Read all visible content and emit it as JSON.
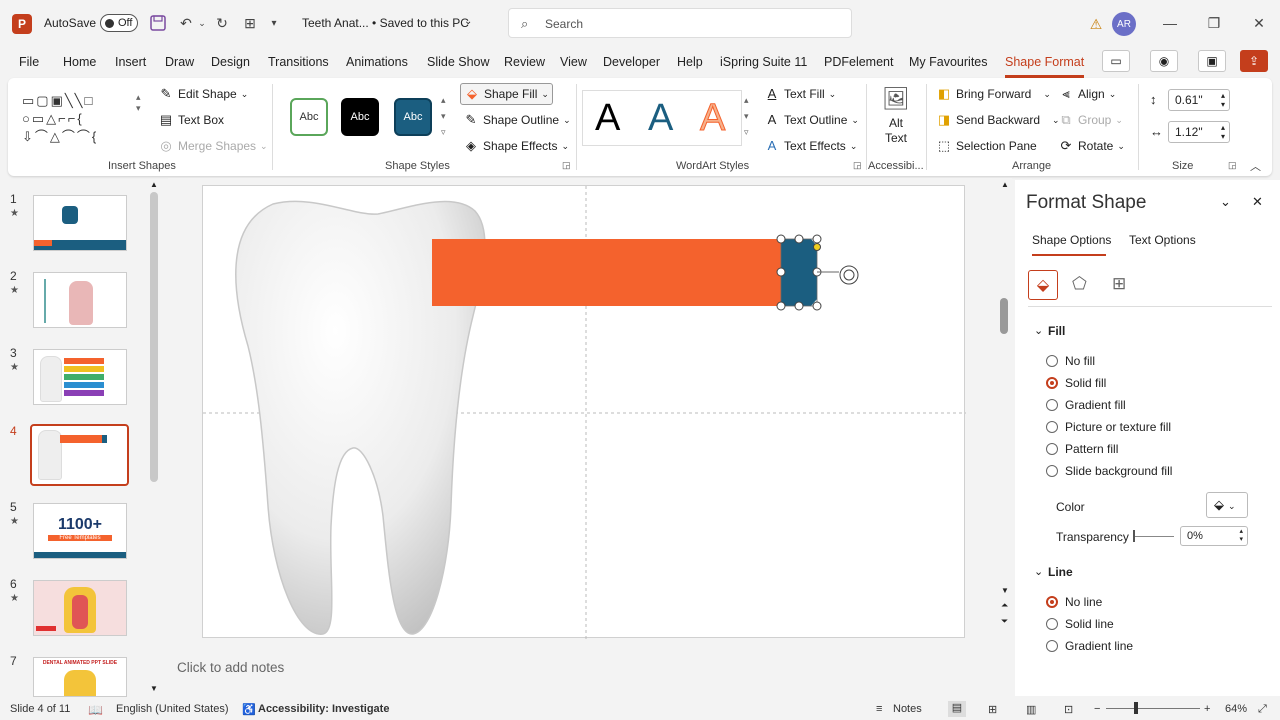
{
  "titlebar": {
    "app_icon": "P",
    "autosave_label": "AutoSave",
    "autosave_state": "Off",
    "doc_title": "Teeth Anat... • Saved to this PC",
    "search_placeholder": "Search",
    "avatar_initials": "AR",
    "warning_icon": "warning-icon"
  },
  "tabs": [
    "File",
    "Home",
    "Insert",
    "Draw",
    "Design",
    "Transitions",
    "Animations",
    "Slide Show",
    "Review",
    "View",
    "Developer",
    "Help",
    "iSpring Suite 11",
    "PDFelement",
    "My Favourites",
    "Shape Format"
  ],
  "active_tab": "Shape Format",
  "ribbon": {
    "insert_shapes": {
      "label": "Insert Shapes",
      "edit_shape": "Edit Shape",
      "text_box": "Text Box",
      "merge_shapes": "Merge Shapes"
    },
    "shape_styles": {
      "label": "Shape Styles",
      "style1": "Abc",
      "style2": "Abc",
      "style3": "Abc",
      "shape_fill": "Shape Fill",
      "shape_outline": "Shape Outline",
      "shape_effects": "Shape Effects"
    },
    "wordart": {
      "label": "WordArt Styles",
      "a1": "A",
      "a2": "A",
      "a3": "A",
      "text_fill": "Text Fill",
      "text_outline": "Text Outline",
      "text_effects": "Text Effects"
    },
    "accessibility": {
      "label": "Accessibi...",
      "alt_text": "Alt Text"
    },
    "arrange": {
      "label": "Arrange",
      "bring_forward": "Bring Forward",
      "send_backward": "Send Backward",
      "selection_pane": "Selection Pane",
      "align": "Align",
      "group": "Group",
      "rotate": "Rotate"
    },
    "size": {
      "label": "Size",
      "height": "0.61\"",
      "width": "1.12\""
    }
  },
  "slides": [
    {
      "num": "1",
      "star": "★"
    },
    {
      "num": "2",
      "star": "★"
    },
    {
      "num": "3",
      "star": "★"
    },
    {
      "num": "4",
      "star": ""
    },
    {
      "num": "5",
      "star": "★",
      "text": "1100+",
      "sub": "Free Templates"
    },
    {
      "num": "6",
      "star": "★"
    },
    {
      "num": "7",
      "star": "",
      "text": "DENTAL ANIMATED PPT SLIDE"
    }
  ],
  "notes_placeholder": "Click to add notes",
  "pane": {
    "title": "Format Shape",
    "tab_shape": "Shape Options",
    "tab_text": "Text Options",
    "fill_header": "Fill",
    "fill_options": [
      "No fill",
      "Solid fill",
      "Gradient fill",
      "Picture or texture fill",
      "Pattern fill",
      "Slide background fill"
    ],
    "fill_selected": "Solid fill",
    "color_label": "Color",
    "transparency_label": "Transparency",
    "transparency_value": "0%",
    "line_header": "Line",
    "line_options": [
      "No line",
      "Solid line",
      "Gradient line"
    ],
    "line_selected": "No line"
  },
  "status": {
    "slide_of": "Slide 4 of 11",
    "language": "English (United States)",
    "accessibility": "Accessibility: Investigate",
    "notes": "Notes",
    "zoom": "64%"
  },
  "colors": {
    "accent": "#c43e1c",
    "orange_shape": "#f4622d",
    "blue_shape": "#1b5e80"
  }
}
